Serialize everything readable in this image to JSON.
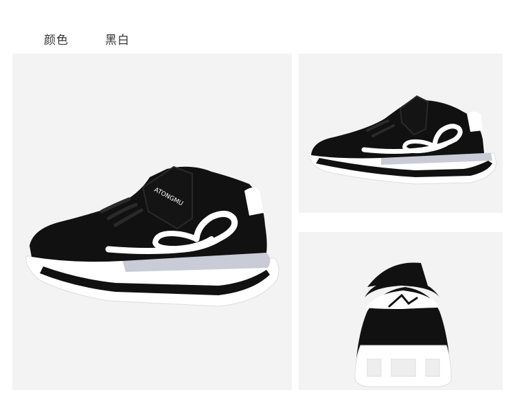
{
  "header": {
    "color_label": "颜色",
    "color_value": "黑白"
  },
  "product": {
    "brand_text": "ATONGMU",
    "colors": {
      "upper": "#111111",
      "trim": "#ffffff",
      "sole_window": "#c9ccd6",
      "background": "#f3f3f3"
    }
  },
  "images": [
    {
      "name": "side-view-large",
      "icon": "sneaker-side-view"
    },
    {
      "name": "side-view-small",
      "icon": "sneaker-side-view"
    },
    {
      "name": "rear-view",
      "icon": "sneaker-rear-view"
    }
  ]
}
